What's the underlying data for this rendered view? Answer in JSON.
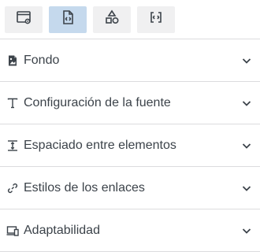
{
  "toolbar": {
    "buttons": [
      {
        "icon": "window-settings-icon",
        "active": false
      },
      {
        "icon": "document-code-icon",
        "active": true
      },
      {
        "icon": "shapes-icon",
        "active": false
      },
      {
        "icon": "code-braces-icon",
        "active": false
      }
    ]
  },
  "sections": [
    {
      "label": "Fondo",
      "icon": "image-icon"
    },
    {
      "label": "Configuración de la fuente",
      "icon": "typography-icon"
    },
    {
      "label": "Espaciado entre elementos",
      "icon": "spacing-icon"
    },
    {
      "label": "Estilos de los enlaces",
      "icon": "link-icon"
    },
    {
      "label": "Adaptabilidad",
      "icon": "responsive-devices-icon"
    }
  ],
  "colors": {
    "active_tab": "#c5d9ed",
    "tab_bg": "#f0f0f1",
    "divider": "#dcdcde",
    "text": "#3c434a"
  }
}
